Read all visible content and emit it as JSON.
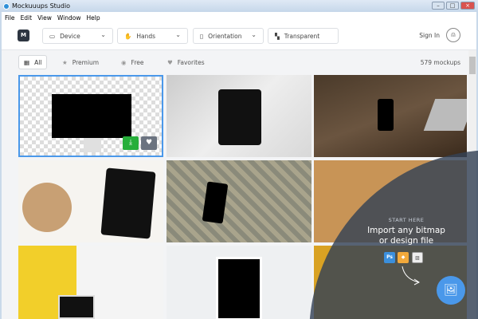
{
  "window": {
    "title": "Mockuuups Studio"
  },
  "menu": [
    "File",
    "Edit",
    "View",
    "Window",
    "Help"
  ],
  "toolbar": {
    "logo": "M",
    "device": "Device",
    "hands": "Hands",
    "orientation": "Orientation",
    "background": "Transparent",
    "sign_in": "Sign In"
  },
  "filters": {
    "all": "All",
    "premium": "Premium",
    "free": "Free",
    "favorites": "Favorites",
    "count": "579 mockups"
  },
  "import": {
    "kicker": "START HERE",
    "line1": "Import any bitmap",
    "line2": "or design file",
    "ps": "Ps"
  },
  "colors": {
    "accent": "#4a98ea",
    "download": "#27ae3b"
  }
}
